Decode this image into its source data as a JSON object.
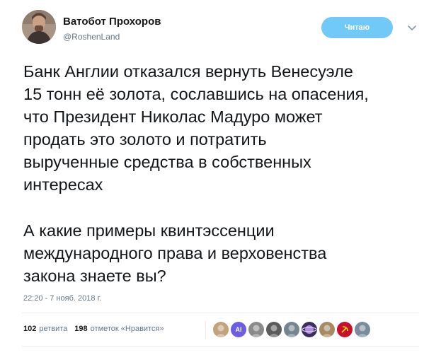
{
  "author": {
    "name": "Ватобот Прохоров",
    "handle": "@RoshenLand"
  },
  "follow_button": "Читаю",
  "tweet": {
    "paragraph1": "Банк Англии отказался вернуть Венесуэле\n15 тонн её золота, сославшись на опасения,\nчто Президент Николас Мадуро может\nпродать это золото и потратить\nвырученные средства в собственных\nинтересах",
    "paragraph2": "А какие примеры квинтэссенции\nмеждународного права и верховенства\nзакона знаете вы?",
    "timestamp": "22:20 - 7 нояб. 2018 г."
  },
  "stats": {
    "retweets_count": "102",
    "retweets_label": "ретвита",
    "likes_count": "198",
    "likes_label": "отметок «Нравится»"
  },
  "likers": [
    {
      "icon": "cat-avatar",
      "color": "#c0a37c",
      "label": ""
    },
    {
      "icon": "ai-avatar",
      "color": "#6c5ce7",
      "label": "AI"
    },
    {
      "icon": "person-avatar",
      "color": "#8a8a8a",
      "label": ""
    },
    {
      "icon": "person-avatar",
      "color": "#5c5c5c",
      "label": ""
    },
    {
      "icon": "person-avatar",
      "color": "#74858f",
      "label": ""
    },
    {
      "icon": "planet-avatar",
      "color": "#3a2f5c",
      "label": ""
    },
    {
      "icon": "person-avatar",
      "color": "#a68a64",
      "label": ""
    },
    {
      "icon": "hammer-sickle-avatar",
      "color": "#c8102e",
      "label": ""
    },
    {
      "icon": "person-avatar",
      "color": "#7a8c9a",
      "label": ""
    }
  ],
  "colors": {
    "follow_button_bg": "#71c9f8",
    "secondary_text": "#657786",
    "primary_text": "#14171a",
    "divider": "#e6ecf0"
  }
}
